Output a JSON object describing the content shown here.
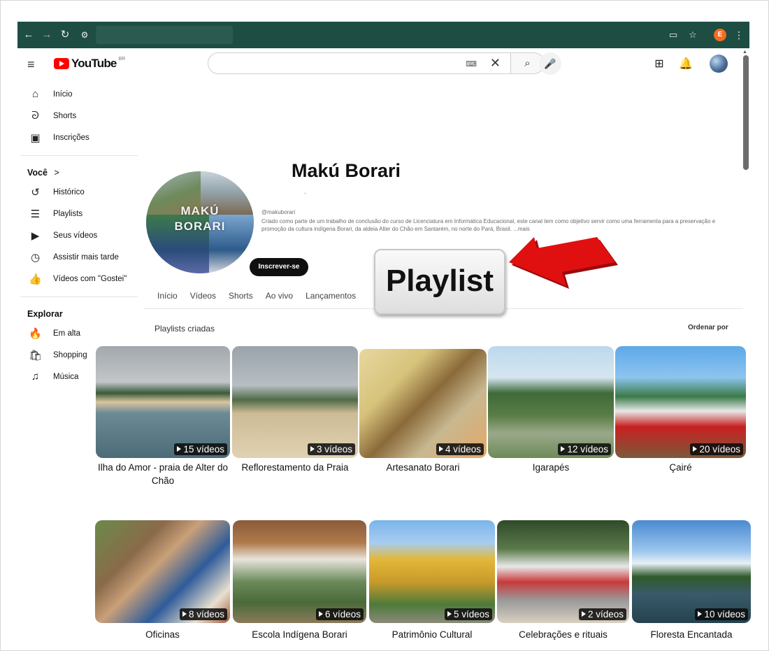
{
  "browser": {
    "back_icon": "arrow-left-icon",
    "forward_icon": "arrow-right-icon",
    "reload_icon": "reload-icon",
    "site_settings_icon": "tune-icon",
    "cast_icon": "cast-icon",
    "bookmark_icon": "star-icon",
    "profile_letter": "E",
    "menu_icon": "kebab-icon",
    "chrome_color": "#1e4d43"
  },
  "header": {
    "logo_text": "YouTube",
    "country_code": "BR",
    "search_value": "",
    "keyboard_glyph": "⌨",
    "clear_glyph": "✕",
    "search_glyph": "⌕"
  },
  "sidebar": {
    "main": [
      {
        "label": "Início",
        "icon": "home-icon"
      },
      {
        "label": "Shorts",
        "icon": "shorts-icon"
      },
      {
        "label": "Inscrições",
        "icon": "subscriptions-icon"
      }
    ],
    "you_heading": "Você",
    "you_chevron": ">",
    "you": [
      {
        "label": "Histórico",
        "icon": "history-icon"
      },
      {
        "label": "Playlists",
        "icon": "playlists-icon"
      },
      {
        "label": "Seus vídeos",
        "icon": "your-videos-icon"
      },
      {
        "label": "Assistir mais tarde",
        "icon": "watch-later-icon"
      },
      {
        "label": "Vídeos com \"Gostei\"",
        "icon": "like-icon"
      }
    ],
    "explore_heading": "Explorar",
    "explore": [
      {
        "label": "Em alta",
        "icon": "trending-icon"
      },
      {
        "label": "Shopping",
        "icon": "shopping-icon"
      },
      {
        "label": "Música",
        "icon": "music-icon"
      }
    ]
  },
  "channel": {
    "name": "Makú Borari",
    "dot": ".",
    "avatar_text_1": "MAKÚ",
    "avatar_text_2": "BORARI",
    "handle": "@makuborari",
    "description": "Criado como parte de um trabalho de conclusão do curso de Licenciatura em Informática Educacional, este canal tem como objetivo servir como uma ferramenta para a preservação e promoção da cultura indígena Borari, da aldeia Alter do Chão em Santarém, no norte do Pará, Brasil. ...mais",
    "subscribe_label": "Inscrever-se"
  },
  "tabs": [
    "Início",
    "Vídeos",
    "Shorts",
    "Ao vivo",
    "Lançamentos"
  ],
  "annotation": {
    "label": "Playlist",
    "arrow_color": "#e01010"
  },
  "section": {
    "title": "Playlists criadas",
    "sort_label": "Ordenar por"
  },
  "playlists": [
    {
      "title": "Ilha do Amor - praia de Alter do Chão",
      "count": "15 vídeos"
    },
    {
      "title": "Reflorestamento da Praia",
      "count": "3 vídeos"
    },
    {
      "title": "Artesanato Borari",
      "count": "4 vídeos"
    },
    {
      "title": "Igarapés",
      "count": "12 vídeos"
    },
    {
      "title": "Çairé",
      "count": "20 vídeos"
    },
    {
      "title": "Oficinas",
      "count": "8 vídeos"
    },
    {
      "title": "Escola Indígena Borari",
      "count": "6 vídeos"
    },
    {
      "title": "Patrimônio Cultural",
      "count": "5 vídeos"
    },
    {
      "title": "Celebrações e rituais",
      "count": "2 vídeos"
    },
    {
      "title": "Floresta Encantada",
      "count": "10 vídeos"
    }
  ]
}
